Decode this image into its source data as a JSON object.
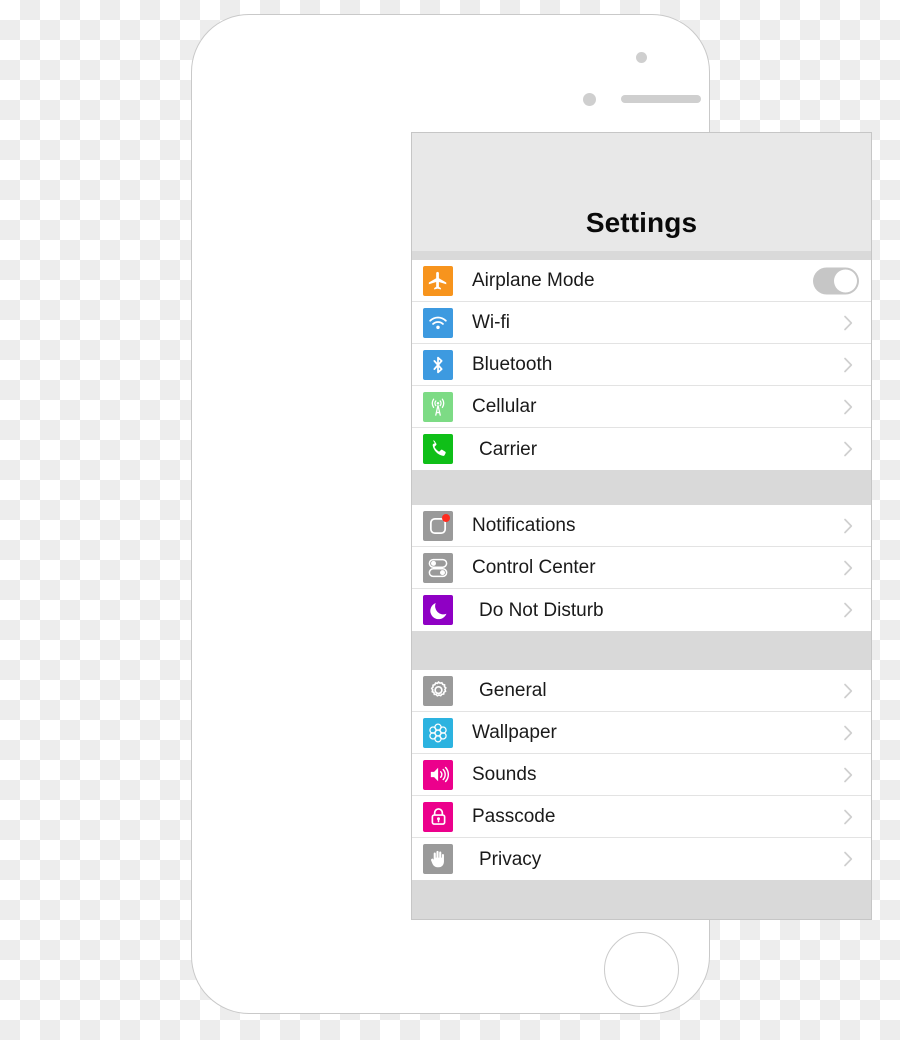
{
  "device": {
    "name": "iphone-mockup",
    "camera_icon": "camera-dot-icon",
    "sensor_icon": "proximity-sensor-icon",
    "speaker_icon": "earpiece-speaker-icon",
    "home_button_label": "home-button"
  },
  "screen": {
    "header": {
      "title": "Settings"
    },
    "groups": [
      {
        "rows": [
          {
            "label": "Airplane Mode",
            "icon": "airplane-icon",
            "icon_class": "ic-airplane",
            "icon_color": "#F7941D",
            "accessory": "toggle",
            "toggle_state": "off",
            "indented": false
          },
          {
            "label": "Wi-fi",
            "icon": "wifi-icon",
            "icon_class": "ic-wifi",
            "icon_color": "#3D9AE0",
            "accessory": "chevron",
            "indented": false
          },
          {
            "label": "Bluetooth",
            "icon": "bluetooth-icon",
            "icon_class": "ic-bluetooth",
            "icon_color": "#3D9AE0",
            "accessory": "chevron",
            "indented": false
          },
          {
            "label": "Cellular",
            "icon": "cellular-tower-icon",
            "icon_class": "ic-cellular",
            "icon_color": "#7DDB85",
            "accessory": "chevron",
            "indented": false
          },
          {
            "label": "Carrier",
            "icon": "phone-handset-icon",
            "icon_class": "ic-carrier",
            "icon_color": "#0FBF18",
            "accessory": "chevron",
            "indented": true
          }
        ]
      },
      {
        "rows": [
          {
            "label": "Notifications",
            "icon": "notification-badge-icon",
            "icon_class": "ic-notif",
            "icon_color": "#9A9A9A",
            "badge_color": "#FF2D20",
            "accessory": "chevron",
            "indented": false
          },
          {
            "label": "Control Center",
            "icon": "sliders-toggle-icon",
            "icon_class": "ic-control",
            "icon_color": "#9A9A9A",
            "accessory": "chevron",
            "indented": false
          },
          {
            "label": "Do Not Disturb",
            "icon": "crescent-moon-icon",
            "icon_class": "ic-dnd",
            "icon_color": "#8F00C4",
            "accessory": "chevron",
            "indented": true
          }
        ]
      },
      {
        "rows": [
          {
            "label": "General",
            "icon": "gear-icon",
            "icon_class": "ic-general",
            "icon_color": "#9A9A9A",
            "accessory": "chevron",
            "indented": true
          },
          {
            "label": "Wallpaper",
            "icon": "flower-rosette-icon",
            "icon_class": "ic-wallpaper",
            "icon_color": "#2CB3E0",
            "accessory": "chevron",
            "indented": false
          },
          {
            "label": "Sounds",
            "icon": "speaker-volume-icon",
            "icon_class": "ic-sounds",
            "icon_color": "#EC008C",
            "accessory": "chevron",
            "indented": false
          },
          {
            "label": "Passcode",
            "icon": "lock-icon",
            "icon_class": "ic-passcode",
            "icon_color": "#EC008C",
            "accessory": "chevron",
            "indented": false
          },
          {
            "label": "Privacy",
            "icon": "raised-hand-icon",
            "icon_class": "ic-privacy",
            "icon_color": "#9A9A9A",
            "accessory": "chevron",
            "indented": true
          }
        ]
      }
    ]
  }
}
